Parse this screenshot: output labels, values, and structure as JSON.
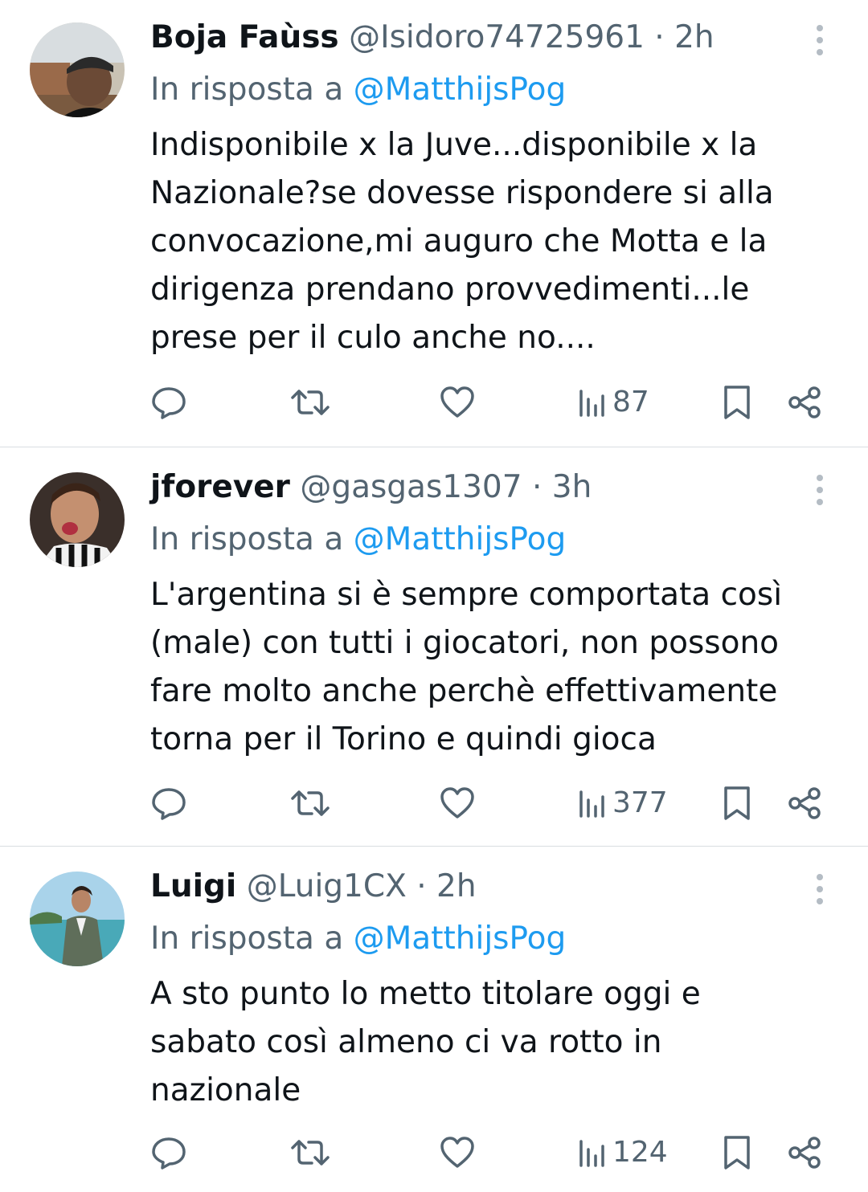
{
  "colors": {
    "text": "#0f1419",
    "muted": "#536471",
    "link": "#1d9bf0",
    "divider": "#d9dde1"
  },
  "icons": [
    "reply-icon",
    "retweet-icon",
    "like-icon",
    "views-icon",
    "bookmark-icon",
    "share-icon",
    "more-icon"
  ],
  "tweets": [
    {
      "name": "Boja Faùss",
      "handle": "@Isidoro74725961",
      "separator": "·",
      "time": "2h",
      "reply_prefix": "In risposta a",
      "reply_to": "@MatthijsPog",
      "text": "Indisponibile x la Juve...disponibile x la\nNazionale?se dovesse rispondere si alla\nconvocazione,mi auguro che Motta e la\ndirigenza prendano provvedimenti...le\nprese per il culo anche no....",
      "views": "87"
    },
    {
      "name": "jforever",
      "handle": "@gasgas1307",
      "separator": "·",
      "time": "3h",
      "reply_prefix": "In risposta a",
      "reply_to": "@MatthijsPog",
      "text": "L'argentina si è sempre comportata così\n(male) con tutti i giocatori, non possono\nfare molto anche perchè effettivamente\ntorna per il Torino e quindi gioca",
      "views": "377"
    },
    {
      "name": "Luigi",
      "handle": "@Luig1CX",
      "separator": "·",
      "time": "2h",
      "reply_prefix": "In risposta a",
      "reply_to": "@MatthijsPog",
      "text": "A sto punto lo metto titolare oggi e\nsabato così almeno ci va rotto in\nnazionale",
      "views": "124"
    }
  ]
}
